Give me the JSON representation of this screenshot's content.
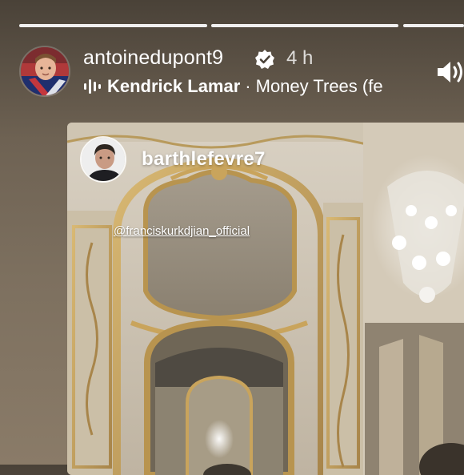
{
  "story": {
    "segments": [
      {
        "state": "viewed"
      },
      {
        "state": "current"
      },
      {
        "state": "upcoming"
      }
    ],
    "username": "antoinedupont9",
    "verified": true,
    "time": "4 h",
    "music": {
      "icon": "music-waveform-icon",
      "artist": "Kendrick Lamar",
      "separator": "·",
      "song": "Money Trees (fe"
    },
    "volume_icon": "speaker-icon",
    "reshared": {
      "username": "barthlefevre7",
      "mention": "@franciskurkdjian_official"
    }
  },
  "colors": {
    "text": "#ffffff",
    "background": "#6e6253",
    "gold": "#c9a45c"
  }
}
